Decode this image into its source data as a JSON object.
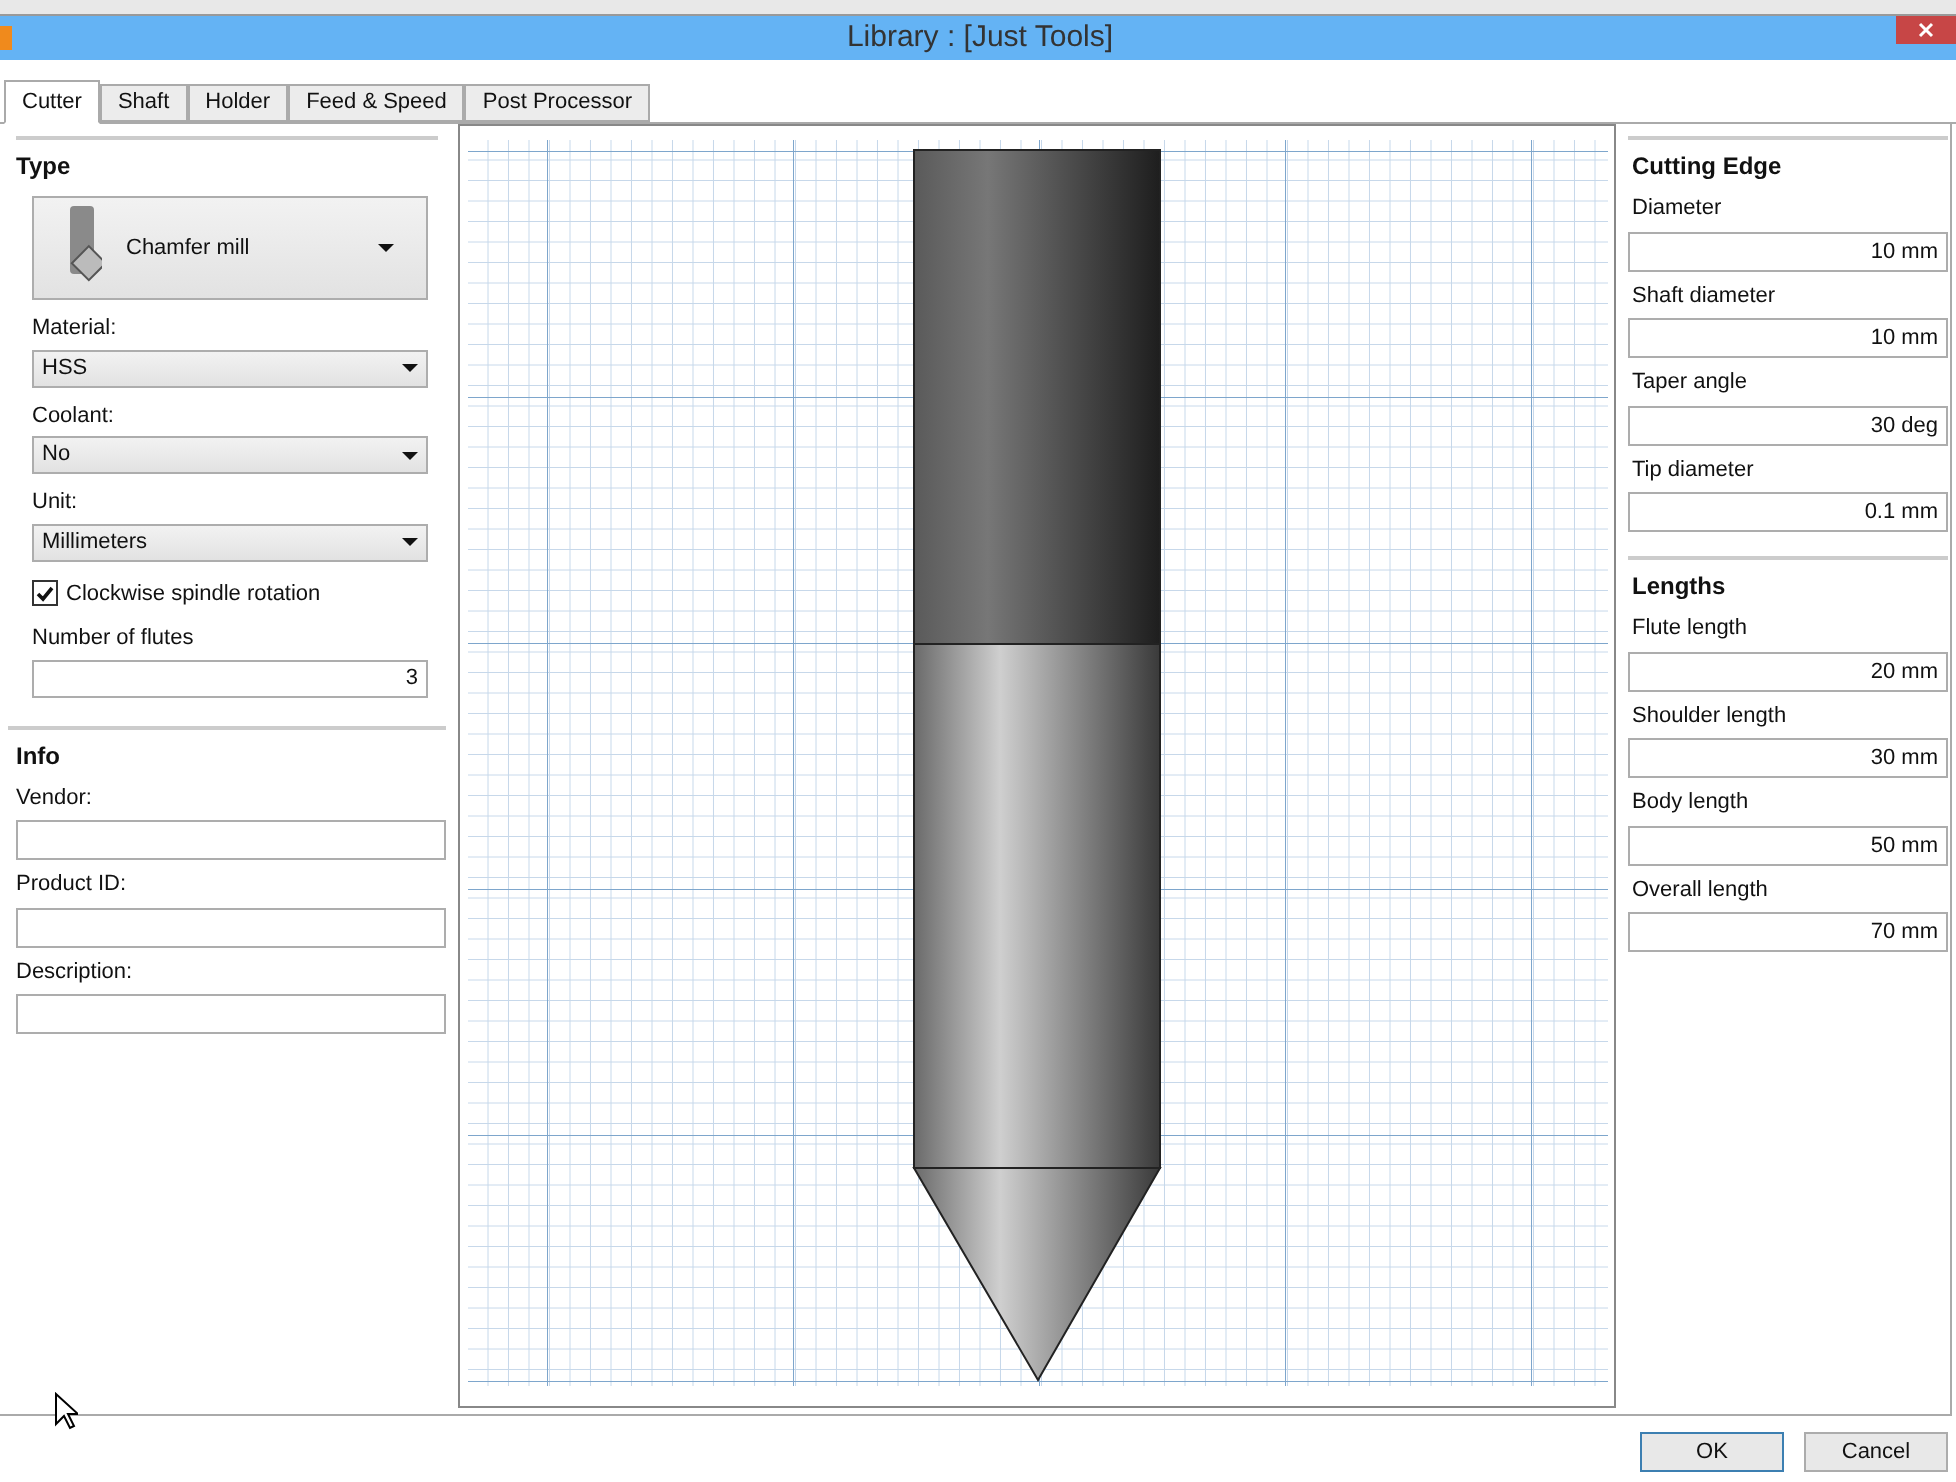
{
  "window": {
    "title": "Library :  [Just Tools]"
  },
  "tabs": [
    {
      "label": "Cutter",
      "selected": true
    },
    {
      "label": "Shaft",
      "selected": false
    },
    {
      "label": "Holder",
      "selected": false
    },
    {
      "label": "Feed & Speed",
      "selected": false
    },
    {
      "label": "Post Processor",
      "selected": false
    }
  ],
  "type_section": {
    "heading": "Type",
    "tool_type": "Chamfer mill",
    "dropdowns": [
      {
        "label": "Material:",
        "value": "HSS"
      },
      {
        "label": "Coolant:",
        "value": "No"
      },
      {
        "label": "Unit:",
        "value": "Millimeters"
      }
    ],
    "clockwise": {
      "label": "Clockwise spindle rotation",
      "checked": true
    },
    "flutes": {
      "label": "Number of flutes",
      "value": "3"
    }
  },
  "info": {
    "heading": "Info",
    "fields": [
      {
        "label": "Vendor:"
      },
      {
        "label": "Product ID:"
      },
      {
        "label": "Description:"
      }
    ]
  },
  "cutting_edge": {
    "heading": "Cutting Edge",
    "fields": [
      {
        "label": "Diameter",
        "value": "10 mm"
      },
      {
        "label": "Shaft diameter",
        "value": "10 mm"
      },
      {
        "label": "Taper angle",
        "value": "30 deg"
      },
      {
        "label": "Tip diameter",
        "value": "0.1 mm"
      }
    ]
  },
  "lengths": {
    "heading": "Lengths",
    "fields": [
      {
        "label": "Flute length",
        "value": "20 mm"
      },
      {
        "label": "Shoulder length",
        "value": "30 mm"
      },
      {
        "label": "Body length",
        "value": "50 mm"
      },
      {
        "label": "Overall length",
        "value": "70 mm"
      }
    ]
  },
  "buttons": [
    "OK",
    "Cancel"
  ]
}
